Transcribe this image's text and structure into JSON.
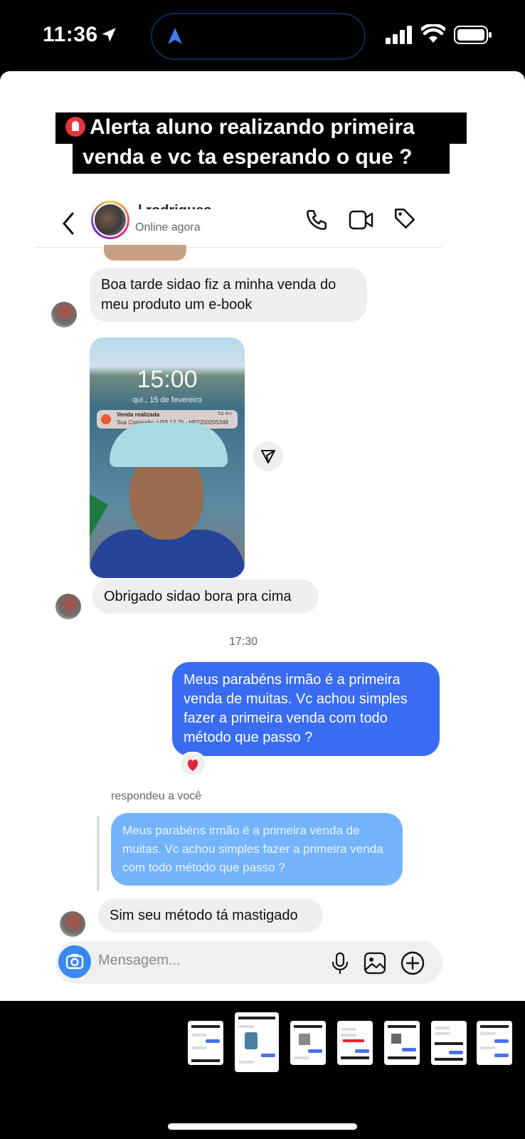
{
  "status_bar": {
    "time": "11:36"
  },
  "caption": {
    "line1": "Alerta aluno realizando primeira",
    "line2": "venda e vc ta esperando o que ?"
  },
  "chat_header": {
    "contact_name": "l rodrigues",
    "status": "Online agora"
  },
  "messages": {
    "incoming_1": "Boa tarde sidao fiz a minha venda do meu produto um e-book",
    "photo": {
      "clock": "15:00",
      "date": "qui., 15 de fevereiro",
      "notification_title": "Venda realizada",
      "notification_body": "Sua Comissão: US$ 12,76 - HP2200205348",
      "notification_time": "há 4m"
    },
    "incoming_2": "Obrigado sidao bora pra cima",
    "timestamp": "17:30",
    "outgoing_1": "Meus parabéns irmão é a primeira venda de muitas. Vc achou simples fazer a primeira venda com todo método que passo ?",
    "reaction": "❤️",
    "reply_label": "respondeu a você",
    "quoted": "Meus parabéns irmão é a primeira venda de muitas. Vc achou simples fazer a primeira venda com todo método que passo ?",
    "incoming_3": "Sim seu método tá mastigado"
  },
  "composer": {
    "placeholder": "Mensagem..."
  },
  "colors": {
    "outgoing_bubble": "#3a6cf2",
    "reply_bubble": "#74b4fb",
    "incoming_bubble": "#efefef",
    "camera_button": "#3a88f0"
  },
  "icons": [
    "location-arrow-icon",
    "signal-icon",
    "wifi-icon",
    "battery-icon",
    "back-icon",
    "phone-icon",
    "video-icon",
    "tag-icon",
    "share-icon",
    "camera-icon",
    "microphone-icon",
    "gallery-icon",
    "plus-icon"
  ]
}
